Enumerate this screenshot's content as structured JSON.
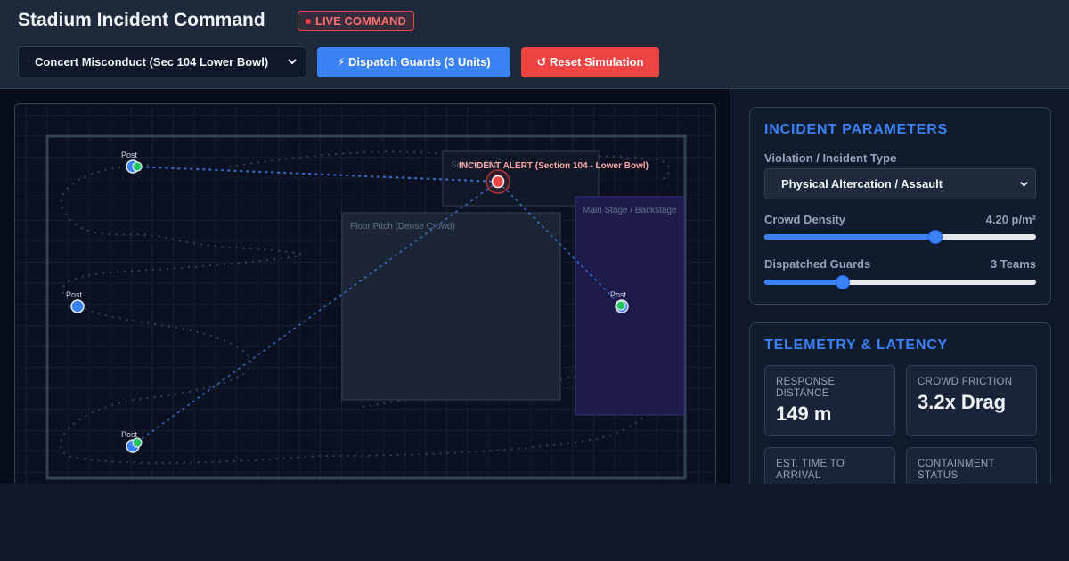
{
  "header": {
    "title": "Stadium Incident Command",
    "live_badge": "LIVE COMMAND",
    "scenario_selected": "Concert Misconduct (Sec 104 Lower Bowl)",
    "dispatch_label": "⚡ Dispatch Guards (3 Units)",
    "reset_label": "↺ Reset Simulation"
  },
  "map": {
    "alert_label": "INCIDENT ALERT (Section 104 - Lower Bowl)",
    "ghost_label": "Section 104",
    "floor_label": "Floor Pitch (Dense Crowd)",
    "stage_label": "Main Stage / Backstage",
    "post_labels": [
      "Post",
      "Post",
      "Post",
      "Post"
    ]
  },
  "params": {
    "title": "INCIDENT PARAMETERS",
    "type_label": "Violation / Incident Type",
    "type_selected": "Physical Altercation / Assault",
    "density_label": "Crowd Density",
    "density_value": "4.20 p/m²",
    "density_fraction": 0.63,
    "guards_label": "Dispatched Guards",
    "guards_value": "3 Teams",
    "guards_fraction": 0.29
  },
  "telemetry": {
    "title": "TELEMETRY & LATENCY",
    "response_label": "RESPONSE DISTANCE",
    "response_value": "149 m",
    "friction_label": "CROWD FRICTION",
    "friction_value": "3.2x Drag",
    "eta_label": "EST. TIME TO ARRIVAL",
    "containment_label": "CONTAINMENT STATUS"
  },
  "colors": {
    "accent": "#3b82f6",
    "alert": "#ef4444",
    "guard": "#22c55e",
    "stage": "#1e1b4b"
  }
}
